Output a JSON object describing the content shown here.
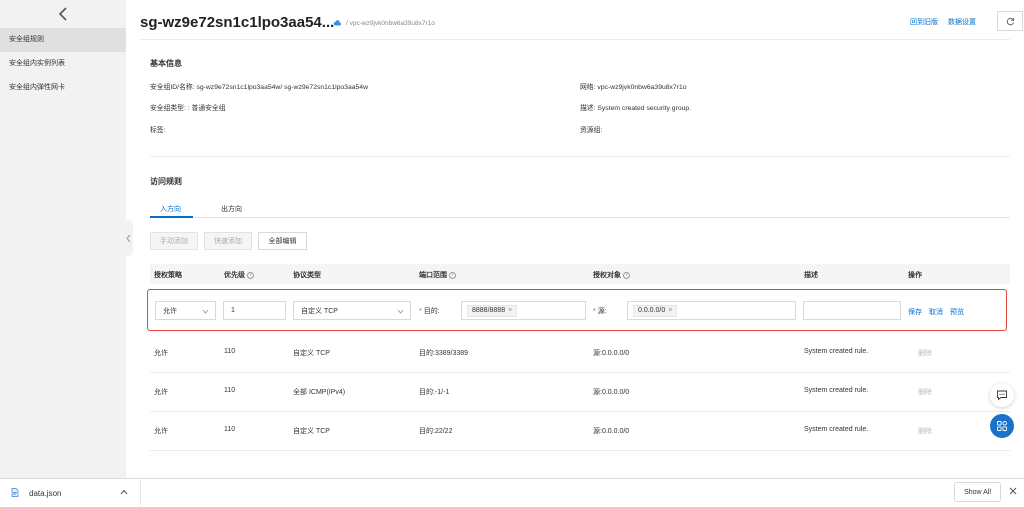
{
  "sidebar": {
    "items": [
      {
        "label": "安全组规则",
        "active": true
      },
      {
        "label": "安全组内实例列表",
        "active": false
      },
      {
        "label": "安全组内弹性网卡",
        "active": false
      }
    ]
  },
  "header": {
    "title": "sg-wz9e72sn1c1lpo3aa54...",
    "vpc_path": "/ vpc-wz9jvk0nbw6a39u8x7r1o",
    "back_old_label": "回到旧版",
    "data_settings_label": "数据设置"
  },
  "basic_info": {
    "title": "基本信息",
    "id_name": "安全组ID/名称:  sg-wz9e72sn1c1lpo3aa54w/ sg-wz9e72sn1c1lpo3aa54w",
    "type": "安全组类型: : 普通安全组",
    "tags": "标签:",
    "network": "网络:  vpc-wz9jvk0nbw6a39u8x7r1o",
    "description": "描述:  System created security group.",
    "resource_group": "资源组:"
  },
  "access_rules": {
    "title": "访问规则",
    "tabs": [
      {
        "label": "入方向",
        "active": true
      },
      {
        "label": "出方向",
        "active": false
      }
    ],
    "buttons": {
      "manual_add": "手动添加",
      "quick_add": "快速添加",
      "edit_all": "全部编辑"
    },
    "columns": [
      "授权策略",
      "优先级",
      "协议类型",
      "端口范围",
      "授权对象",
      "描述",
      "操作"
    ],
    "info_icon": "i",
    "editing_row": {
      "policy": "允许",
      "priority": "1",
      "protocol": "自定义 TCP",
      "dest_label": "目的:",
      "port_tag": "8888/8888",
      "source_label": "源:",
      "source_tag": "0.0.0.0/0",
      "description": "",
      "save": "保存",
      "cancel": "取消",
      "preview": "预览"
    },
    "rows": [
      {
        "policy": "允许",
        "priority": "110",
        "protocol": "自定义 TCP",
        "port": "目的:3389/3389",
        "source": "源:0.0.0.0/0",
        "description": "System created rule.",
        "action": "删除"
      },
      {
        "policy": "允许",
        "priority": "110",
        "protocol": "全部 ICMP(IPv4)",
        "port": "目的:-1/-1",
        "source": "源:0.0.0.0/0",
        "description": "System created rule.",
        "action": "删除"
      },
      {
        "policy": "允许",
        "priority": "110",
        "protocol": "自定义 TCP",
        "port": "目的:22/22",
        "source": "源:0.0.0.0/0",
        "description": "System created rule.",
        "action": "删除"
      }
    ]
  },
  "download_bar": {
    "file_name": "data.json",
    "show_all": "Show All"
  },
  "colors": {
    "accent": "#0070cc",
    "highlight_border": "#e0453a",
    "float_blue": "#1a73c8"
  },
  "icons": [
    "chevron-left-icon",
    "cloud-icon",
    "refresh-icon",
    "chevron-down-icon",
    "info-icon",
    "chat-icon",
    "grid-apps-icon",
    "file-icon",
    "close-icon"
  ]
}
